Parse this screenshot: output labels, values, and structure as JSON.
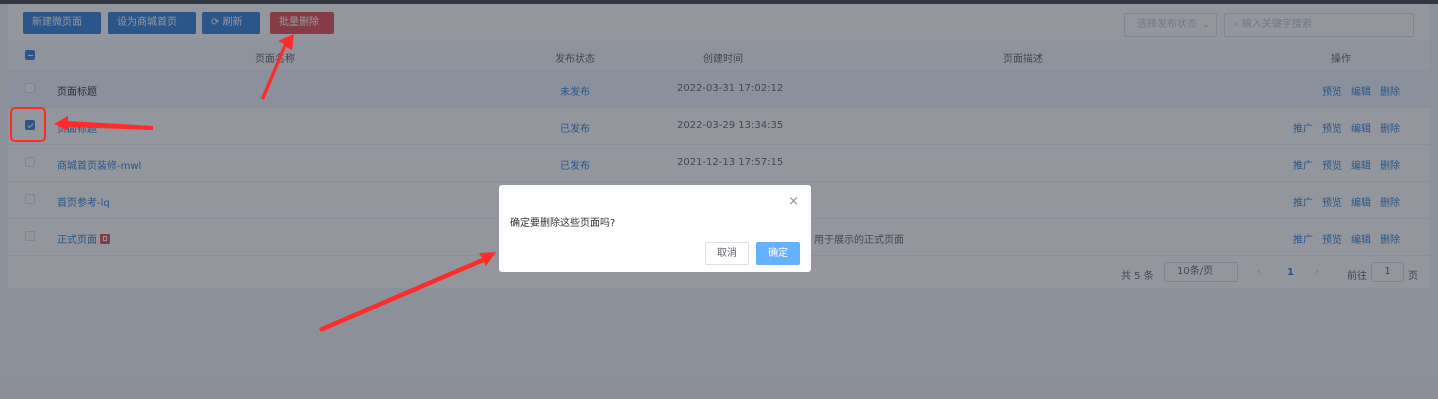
{
  "toolbar": {
    "new_label": "新建微页面",
    "set_home_label": "设为商城首页",
    "refresh_label": "刷新",
    "batch_delete_label": "批量删除",
    "status_select_placeholder": "选择发布状态",
    "search_placeholder": "输入关键字搜索"
  },
  "table": {
    "headers": {
      "name": "页面名称",
      "status": "发布状态",
      "created": "创建时间",
      "desc": "页面描述",
      "ops": "操作"
    },
    "rows": [
      {
        "name": "页面标题",
        "status": "未发布",
        "created": "2022-03-31 17:02:12",
        "desc": "",
        "checked": false,
        "ops": [
          "预览",
          "编辑",
          "删除"
        ]
      },
      {
        "name": "页面标题",
        "status": "已发布",
        "created": "2022-03-29 13:34:35",
        "desc": "",
        "checked": true,
        "ops": [
          "推广",
          "预览",
          "编辑",
          "删除"
        ]
      },
      {
        "name": "商城首页装修-mwl",
        "status": "已发布",
        "created": "2021-12-13 17:57:15",
        "desc": "",
        "checked": false,
        "ops": [
          "推广",
          "预览",
          "编辑",
          "删除"
        ]
      },
      {
        "name": "首页参考-lq",
        "status": "",
        "created": "",
        "desc": "",
        "checked": false,
        "ops": [
          "推广",
          "预览",
          "编辑",
          "删除"
        ]
      },
      {
        "name": "正式页面",
        "status": "",
        "created": "",
        "desc": "用于展示的正式页面",
        "checked": false,
        "ops": [
          "推广",
          "预览",
          "编辑",
          "删除"
        ]
      }
    ]
  },
  "pagination": {
    "total": "共 5 条",
    "page_size": "10条/页",
    "current": "1",
    "goto_label": "前往",
    "goto_value": "1",
    "page_suffix": "页"
  },
  "dialog": {
    "message": "确定要删除这些页面吗?",
    "cancel_label": "取消",
    "confirm_label": "确定",
    "close_glyph": "×"
  },
  "colors": {
    "primary": "#2d7fd8",
    "danger": "#e34b53",
    "annotation": "#ff2a2a"
  }
}
